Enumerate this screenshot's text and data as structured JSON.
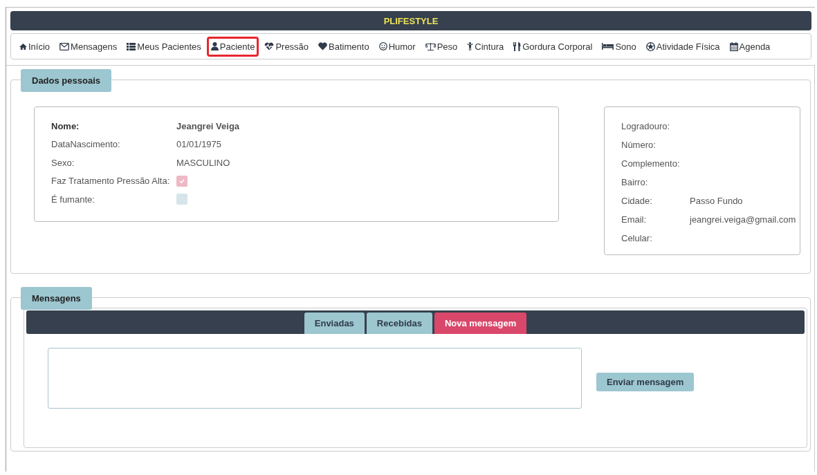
{
  "header": {
    "title": "PLIFESTYLE"
  },
  "nav": [
    {
      "label": "Início",
      "kind": "home",
      "selected": false
    },
    {
      "label": "Mensagens",
      "kind": "mail",
      "selected": false
    },
    {
      "label": "Meus Pacientes",
      "kind": "list",
      "selected": false
    },
    {
      "label": "Paciente",
      "kind": "user",
      "selected": true
    },
    {
      "label": "Pressão",
      "kind": "heartbeat",
      "selected": false
    },
    {
      "label": "Batimento",
      "kind": "heart",
      "selected": false
    },
    {
      "label": "Humor",
      "kind": "smile",
      "selected": false
    },
    {
      "label": "Peso",
      "kind": "scale",
      "selected": false
    },
    {
      "label": "Cintura",
      "kind": "person",
      "selected": false
    },
    {
      "label": "Gordura Corporal",
      "kind": "cutlery",
      "selected": false
    },
    {
      "label": "Sono",
      "kind": "bed",
      "selected": false
    },
    {
      "label": "Atividade Física",
      "kind": "ball",
      "selected": false
    },
    {
      "label": "Agenda",
      "kind": "calendar",
      "selected": false
    }
  ],
  "personal": {
    "legend": "Dados pessoais",
    "fields": [
      {
        "label": "Nome:",
        "value": "Jeangrei Veiga",
        "kind": "bold"
      },
      {
        "label": "DataNascimento:",
        "value": "01/01/1975",
        "kind": "text"
      },
      {
        "label": "Sexo:",
        "value": "MASCULINO",
        "kind": "text"
      },
      {
        "label": "Faz Tratamento Pressão Alta:",
        "checked": true,
        "kind": "checkbox"
      },
      {
        "label": "É fumante:",
        "checked": false,
        "kind": "checkbox"
      }
    ],
    "address": [
      {
        "label": "Logradouro:"
      },
      {
        "label": "Número:"
      },
      {
        "label": "Complemento:"
      },
      {
        "label": "Bairro:"
      },
      {
        "label": "Cidade:",
        "value": "Passo Fundo"
      },
      {
        "label": "Email:",
        "value": "jeangrei.veiga@gmail.com"
      },
      {
        "label": "Celular:"
      }
    ]
  },
  "messages": {
    "legend": "Mensagens",
    "tabs": [
      {
        "label": "Enviadas",
        "selected": false
      },
      {
        "label": "Recebidas",
        "selected": false
      },
      {
        "label": "Nova mensagem",
        "selected": true
      }
    ],
    "send_button": "Enviar mensagem"
  }
}
